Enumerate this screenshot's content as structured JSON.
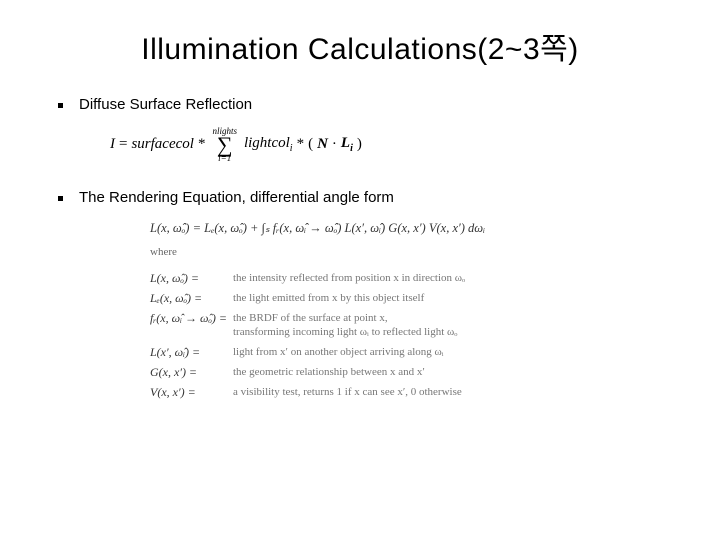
{
  "title": "Illumination Calculations(2~3쪽)",
  "bullets": {
    "b1": "Diffuse Surface Reflection",
    "b2": "The Rendering Equation, differential angle form"
  },
  "eq1": {
    "lhs": "I",
    "eq": "=",
    "surfacecol": "surfacecol",
    "star1": "*",
    "sum_top": "nlights",
    "sum_sym": "∑",
    "sum_bot": "i=1",
    "lightcol": "lightcol",
    "sub_i": "i",
    "star2": "*",
    "lparen": "(",
    "N": "N",
    "dot": "·",
    "L": "L",
    "sub_i2": "i",
    "rparen": ")"
  },
  "eq2": {
    "main": "L(x, ω̂ₒ) = Lₑ(x, ω̂ₒ) + ∫ₛ fᵣ(x, ω̂ᵢ → ω̂ₒ) L(x′, ω̂ᵢ) G(x, x′) V(x, x′) dωᵢ",
    "where": "where",
    "defs": [
      {
        "lhs": "L(x, ω̂ₒ) =",
        "rhs": "the intensity reflected from position x in direction ωₒ"
      },
      {
        "lhs": "Lₑ(x, ω̂ₒ) =",
        "rhs": "the light emitted from x by this object itself"
      },
      {
        "lhs": "fᵣ(x, ω̂ᵢ → ω̂ₒ) =",
        "rhs": "the BRDF of the surface at point x,\ntransforming incoming light ωᵢ to reflected light ωₒ"
      },
      {
        "lhs": "L(x′, ω̂ᵢ) =",
        "rhs": "light from x′ on another object arriving along ωᵢ"
      },
      {
        "lhs": "G(x, x′) =",
        "rhs": "the geometric relationship between x and x′"
      },
      {
        "lhs": "V(x, x′) =",
        "rhs": "a visibility test, returns 1 if x can see x′, 0 otherwise"
      }
    ]
  }
}
